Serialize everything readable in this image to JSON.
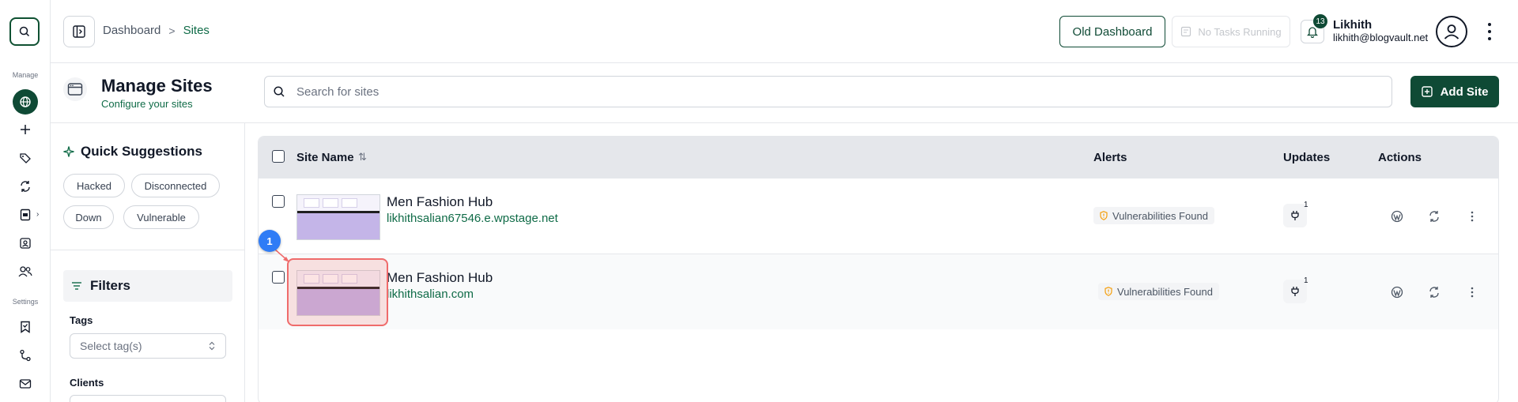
{
  "breadcrumb": {
    "items": [
      "Dashboard",
      "Sites"
    ],
    "separator": ">"
  },
  "header": {
    "old_dashboard_label": "Old Dashboard",
    "tasks_label": "No Tasks Running",
    "notification_count": "13",
    "user_name": "Likhith",
    "user_email": "likhith@blogvault.net"
  },
  "rail": {
    "manage_label": "Manage",
    "settings_label": "Settings",
    "icons": [
      "search-icon",
      "globe-icon",
      "plus-icon",
      "tags-icon",
      "sync-icon",
      "report-icon",
      "contacts-icon",
      "users-icon",
      "bookmark-icon",
      "workflow-icon",
      "mail-icon"
    ]
  },
  "page": {
    "title": "Manage Sites",
    "subtitle": "Configure your sites",
    "search_placeholder": "Search for sites",
    "add_site_label": "Add Site"
  },
  "sidebar": {
    "quick_suggestions_title": "Quick Suggestions",
    "chips": [
      "Hacked",
      "Disconnected",
      "Down",
      "Vulnerable"
    ],
    "filters_title": "Filters",
    "tags_label": "Tags",
    "tags_placeholder": "Select tag(s)",
    "clients_label": "Clients"
  },
  "table": {
    "columns": [
      "Site Name",
      "Alerts",
      "Updates",
      "Actions"
    ],
    "rows": [
      {
        "name": "Men Fashion Hub",
        "url": "likhithsalian67546.e.wpstage.net",
        "alert": "Vulnerabilities Found",
        "updates": "1"
      },
      {
        "name": "Men Fashion Hub",
        "url": "likhithsalian.com",
        "alert": "Vulnerabilities Found",
        "updates": "1"
      }
    ]
  },
  "annotation": {
    "marker_label": "1",
    "color": "#2f7cf6",
    "highlight_color": "#ef6b6b"
  },
  "colors": {
    "brand": "#0f4a35",
    "accent_text": "#0f6b47",
    "warning": "#f59e0b"
  }
}
